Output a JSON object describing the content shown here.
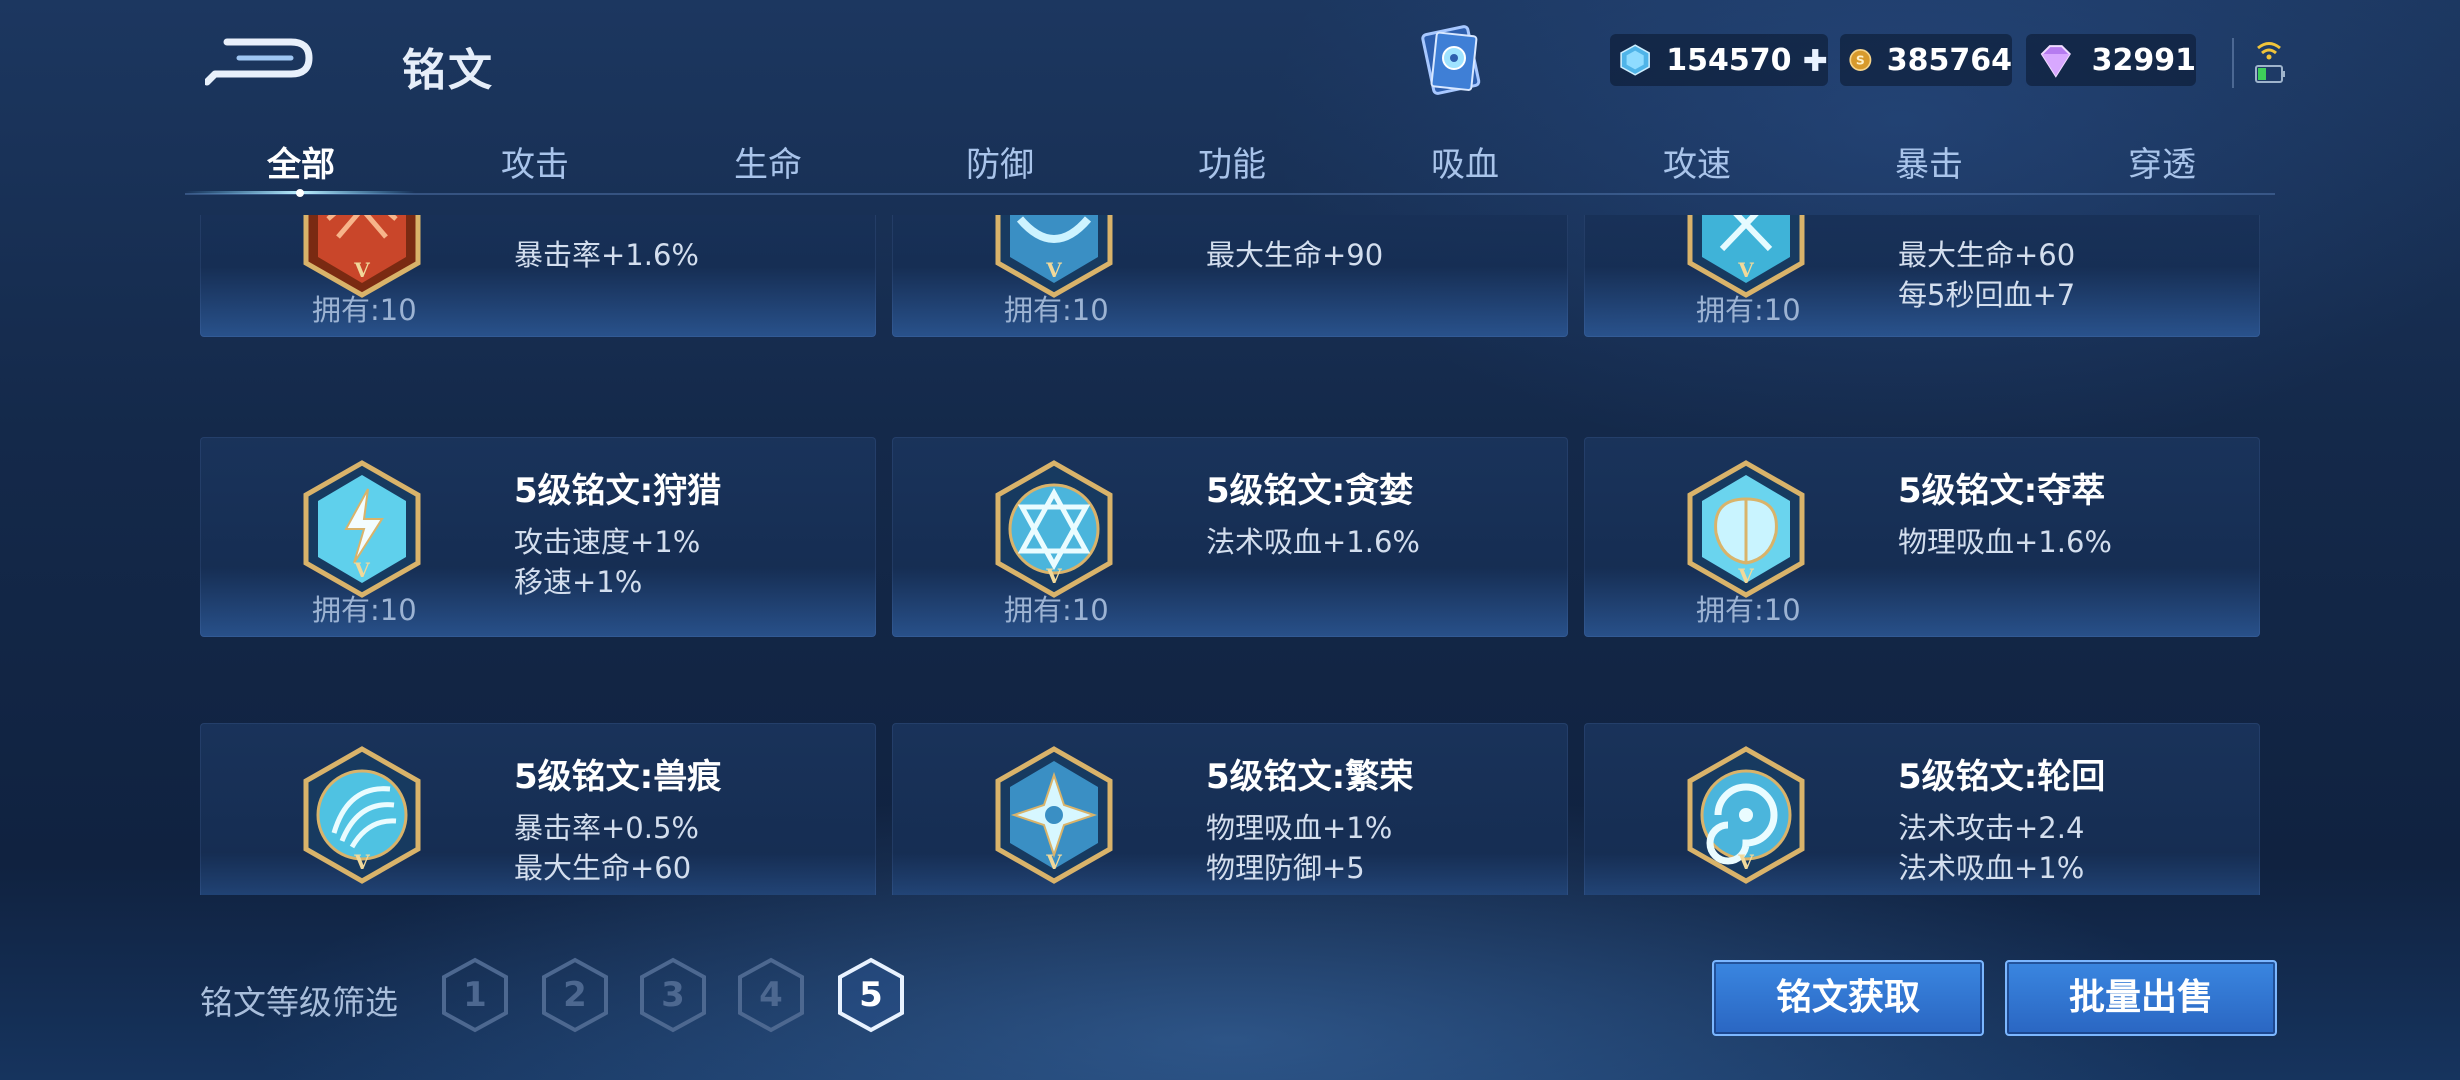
{
  "header": {
    "title": "铭文",
    "resources": [
      {
        "name": "coupon",
        "value": "154570",
        "has_plus": true
      },
      {
        "name": "gold",
        "value": "385764"
      },
      {
        "name": "gem",
        "value": "32991"
      }
    ]
  },
  "tabs": [
    {
      "label": "全部",
      "active": true
    },
    {
      "label": "攻击"
    },
    {
      "label": "生命"
    },
    {
      "label": "防御"
    },
    {
      "label": "功能"
    },
    {
      "label": "吸血"
    },
    {
      "label": "攻速"
    },
    {
      "label": "暴击"
    },
    {
      "label": "穿透"
    }
  ],
  "runes": [
    {
      "name": "",
      "attrs": [
        "暴击率+1.6%"
      ],
      "owned": "拥有:10",
      "style": "red"
    },
    {
      "name": "",
      "attrs": [
        "最大生命+90"
      ],
      "owned": "拥有:10",
      "style": "blue"
    },
    {
      "name": "",
      "attrs": [
        "最大生命+60",
        "每5秒回血+7"
      ],
      "owned": "拥有:10",
      "style": "blue"
    },
    {
      "name": "5级铭文:狩猎",
      "attrs": [
        "攻击速度+1%",
        "移速+1%"
      ],
      "owned": "拥有:10",
      "style": "blue"
    },
    {
      "name": "5级铭文:贪婪",
      "attrs": [
        "法术吸血+1.6%"
      ],
      "owned": "拥有:10",
      "style": "blue"
    },
    {
      "name": "5级铭文:夺萃",
      "attrs": [
        "物理吸血+1.6%"
      ],
      "owned": "拥有:10",
      "style": "blue"
    },
    {
      "name": "5级铭文:兽痕",
      "attrs": [
        "暴击率+0.5%",
        "最大生命+60"
      ],
      "owned": "",
      "style": "blue"
    },
    {
      "name": "5级铭文:繁荣",
      "attrs": [
        "物理吸血+1%",
        "物理防御+5"
      ],
      "owned": "",
      "style": "blue"
    },
    {
      "name": "5级铭文:轮回",
      "attrs": [
        "法术攻击+2.4",
        "法术吸血+1%"
      ],
      "owned": "",
      "style": "blue"
    }
  ],
  "filter": {
    "label": "铭文等级筛选",
    "levels": [
      "1",
      "2",
      "3",
      "4",
      "5"
    ],
    "selected": "5"
  },
  "buttons": {
    "obtain": "铭文获取",
    "sell": "批量出售"
  },
  "colors": {
    "accent": "#3a86e0",
    "gold_frame": "#d9b36a",
    "rune_blue": "#5fd0ec",
    "rune_red": "#c9462a"
  }
}
